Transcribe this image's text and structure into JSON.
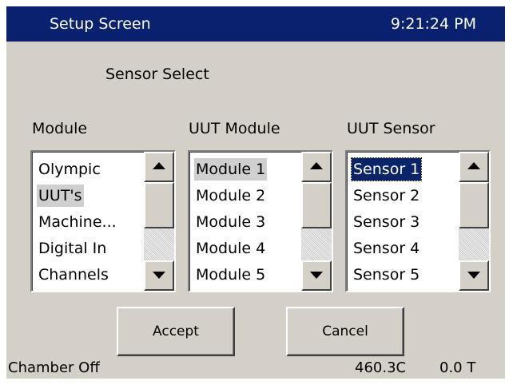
{
  "header": {
    "title": "Setup Screen",
    "time": "9:21:24 PM"
  },
  "section_title": "Sensor Select",
  "columns": [
    {
      "label": "Module",
      "items": [
        "Olympic",
        "UUT's",
        "Machine...",
        "Digital In",
        "Channels"
      ]
    },
    {
      "label": "UUT Module",
      "items": [
        "Module 1",
        "Module 2",
        "Module 3",
        "Module 4",
        "Module 5"
      ]
    },
    {
      "label": "UUT Sensor",
      "items": [
        "Sensor 1",
        "Sensor 2",
        "Sensor 3",
        "Sensor 4",
        "Sensor 5"
      ]
    }
  ],
  "selected": {
    "module": "UUT's",
    "uut_module": "Module 1",
    "uut_sensor": "Sensor 1"
  },
  "buttons": {
    "accept": "Accept",
    "cancel": "Cancel"
  },
  "status": {
    "chamber": "Chamber Off",
    "temperature": "460.3C",
    "value": "0.0 T"
  },
  "colors": {
    "titlebar": "#0a2170",
    "background": "#d4d0c8",
    "selection": "#0a246a"
  },
  "icons": {
    "scroll_up": "up-arrow-icon",
    "scroll_down": "down-arrow-icon"
  }
}
